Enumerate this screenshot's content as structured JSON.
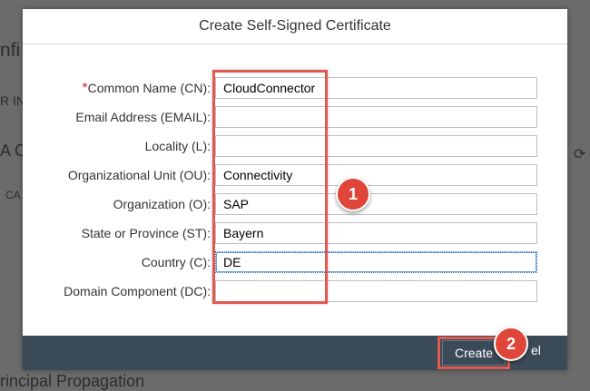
{
  "background": {
    "title_fragment": "nfi",
    "short_fragment": "R IN",
    "section_fragment": "A C",
    "small_fragment": "CA",
    "bottom_fragment": "rincipal Propagation"
  },
  "dialog": {
    "title": "Create Self-Signed Certificate",
    "required_marker": "*",
    "fields": [
      {
        "label": "Common Name (CN):",
        "value": "CloudConnector"
      },
      {
        "label": "Email Address (EMAIL):",
        "value": ""
      },
      {
        "label": "Locality (L):",
        "value": ""
      },
      {
        "label": "Organizational Unit (OU):",
        "value": "Connectivity"
      },
      {
        "label": "Organization (O):",
        "value": "SAP"
      },
      {
        "label": "State or Province (ST):",
        "value": "Bayern"
      },
      {
        "label": "Country (C):",
        "value": "DE"
      },
      {
        "label": "Domain Component (DC):",
        "value": ""
      }
    ],
    "create_label": "Create",
    "cancel_label": "el"
  },
  "callouts": {
    "one": "1",
    "two": "2"
  },
  "colors": {
    "accent_red": "#e05a4f",
    "footer_bg": "#3b4a57",
    "required_red": "#d4232a"
  }
}
